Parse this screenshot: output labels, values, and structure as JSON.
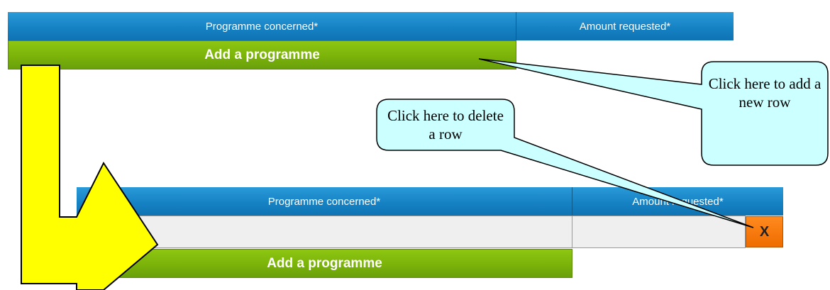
{
  "top_table": {
    "col1_header": "Programme concerned*",
    "col2_header": "Amount requested*",
    "add_button": "Add a programme"
  },
  "bottom_table": {
    "col1_header": "Programme concerned*",
    "col2_header": "Amount requested*",
    "programme_value": "",
    "amount_value": "",
    "delete_button": "X",
    "add_button": "Add a programme"
  },
  "callouts": {
    "add_row": "Click here to add a new row",
    "delete_row": "Click here to delete a row"
  },
  "colors": {
    "header_blue": "#1582c4",
    "button_green": "#7bb30a",
    "delete_orange": "#f57a0f",
    "arrow_yellow": "#ffff00",
    "callout_fill": "#ccffff"
  }
}
